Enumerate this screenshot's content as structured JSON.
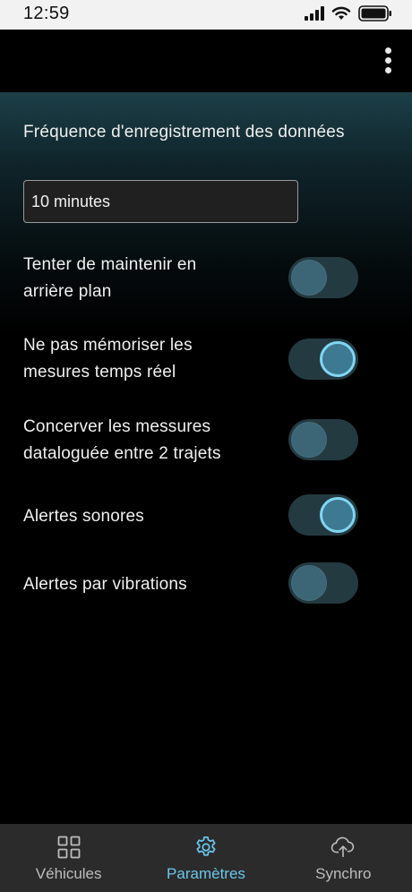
{
  "status_bar": {
    "time": "12:59",
    "icons": [
      "signal-icon",
      "wifi-icon",
      "battery-icon"
    ]
  },
  "header": {
    "menu_icon": "more-vertical-icon"
  },
  "settings": {
    "frequency": {
      "label": "Fréquence d'enregistrement des données",
      "value": "10 minutes"
    },
    "toggles": [
      {
        "line1": "Tenter de maintenir en",
        "line2": "arrière plan",
        "checked": false
      },
      {
        "line1": "Ne pas mémoriser les",
        "line2": "mesures temps réel",
        "checked": true
      },
      {
        "line1": "Concerver les messures",
        "line2": "dataloguée entre 2 trajets",
        "checked": false
      },
      {
        "line1": "Alertes sonores",
        "line2": "",
        "checked": true
      },
      {
        "line1": "Alertes par vibrations",
        "line2": "",
        "checked": false
      }
    ]
  },
  "bottom_nav": {
    "items": [
      {
        "label": "Véhicules",
        "icon": "grid-icon",
        "active": false
      },
      {
        "label": "Paramètres",
        "icon": "gear-icon",
        "active": true
      },
      {
        "label": "Synchro",
        "icon": "cloud-upload-icon",
        "active": false
      }
    ]
  },
  "colors": {
    "accent": "#6ac6ec",
    "toggle_track": "#243a41",
    "toggle_knob_on_border": "#7fd6f2",
    "nav_background": "#2b2b2b"
  }
}
